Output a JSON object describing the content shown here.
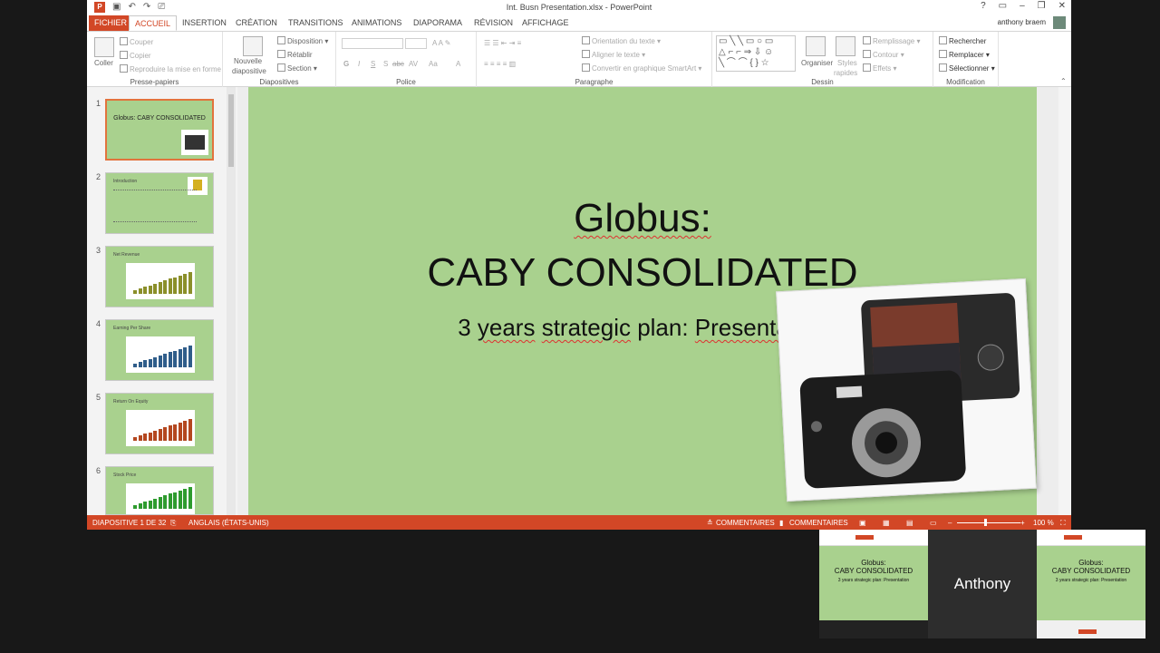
{
  "window": {
    "title": "Int. Busn Presentation.xlsx - PowerPoint",
    "user": "anthony braem",
    "controls": [
      "?",
      "▭",
      "–",
      "❐",
      "✕"
    ]
  },
  "tabs": [
    "FICHIER",
    "ACCUEIL",
    "INSERTION",
    "CRÉATION",
    "TRANSITIONS",
    "ANIMATIONS",
    "DIAPORAMA",
    "RÉVISION",
    "AFFICHAGE"
  ],
  "ribbon": {
    "clipboard": {
      "paste": "Coller",
      "cut": "Couper",
      "copy": "Copier",
      "format_painter": "Reproduire la mise en forme",
      "label": "Presse-papiers"
    },
    "slides": {
      "new_slide": "Nouvelle",
      "new_slide2": "diapositive",
      "layout": "Disposition",
      "reset": "Rétablir",
      "section": "Section",
      "label": "Diapositives"
    },
    "font": {
      "label": "Police",
      "bold": "G",
      "italic": "I",
      "underline": "S",
      "shadow": "S",
      "strike": "abc",
      "spacing": "AV",
      "case": "Aa",
      "color": "A"
    },
    "paragraph": {
      "text_direction": "Orientation du texte",
      "align_text": "Aligner le texte",
      "smartart": "Convertir en graphique SmartArt",
      "label": "Paragraphe"
    },
    "drawing": {
      "arrange": "Organiser",
      "quick_styles": "Styles",
      "quick_styles2": "rapides",
      "fill": "Remplissage",
      "outline": "Contour",
      "effects": "Effets",
      "label": "Dessin"
    },
    "editing": {
      "find": "Rechercher",
      "replace": "Remplacer",
      "select": "Sélectionner",
      "label": "Modification"
    }
  },
  "thumbnails": [
    {
      "num": "1",
      "title": "Globus: CABY CONSOLIDATED"
    },
    {
      "num": "2",
      "title": "Introduction"
    },
    {
      "num": "3",
      "title": "Net Revenue"
    },
    {
      "num": "4",
      "title": "Earning Per Share"
    },
    {
      "num": "5",
      "title": "Return On Equity"
    },
    {
      "num": "6",
      "title": "Stock Price"
    }
  ],
  "slide": {
    "title_line1": "Globus:",
    "title_line2": "CABY CONSOLIDATED",
    "subtitle_a": "3 ",
    "subtitle_b": "years",
    "subtitle_c": " ",
    "subtitle_d": "strategic",
    "subtitle_e": " plan: ",
    "subtitle_f": "Presentation"
  },
  "status": {
    "slide_of": "DIAPOSITIVE 1 DE 32",
    "language": "ANGLAIS (ÉTATS-UNIS)",
    "notes": "COMMENTAIRES",
    "comments": "COMMENTAIRES",
    "zoom": "100 %"
  },
  "video": {
    "participant": "Anthony",
    "mini_line1": "Globus:",
    "mini_line2": "CABY CONSOLIDATED",
    "mini_line3": "3 years strategic plan: Presentation"
  },
  "colors": {
    "accent": "#d24726",
    "slide_bg": "#a9d18e"
  }
}
